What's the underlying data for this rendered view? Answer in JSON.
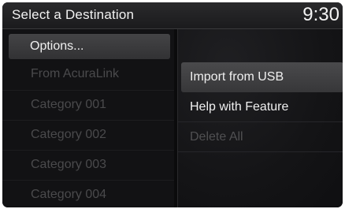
{
  "header": {
    "title": "Select a Destination",
    "clock": "9:30"
  },
  "left_menu": {
    "options_label": "Options...",
    "items": [
      {
        "label": "From AcuraLink",
        "state": "disabled"
      },
      {
        "label": "Category 001",
        "state": "disabled"
      },
      {
        "label": "Category 002",
        "state": "disabled"
      },
      {
        "label": "Category 003",
        "state": "disabled"
      },
      {
        "label": "Category 004",
        "state": "disabled"
      }
    ]
  },
  "options_menu": {
    "items": [
      {
        "label": "Import from USB",
        "state": "selected"
      },
      {
        "label": "Help with Feature",
        "state": "enabled"
      },
      {
        "label": "Delete All",
        "state": "disabled"
      }
    ]
  },
  "colors": {
    "background": "#0b0b0c",
    "text_active": "#f0f0f0",
    "text_disabled": "#4a4a4c",
    "highlight": "#444446"
  }
}
